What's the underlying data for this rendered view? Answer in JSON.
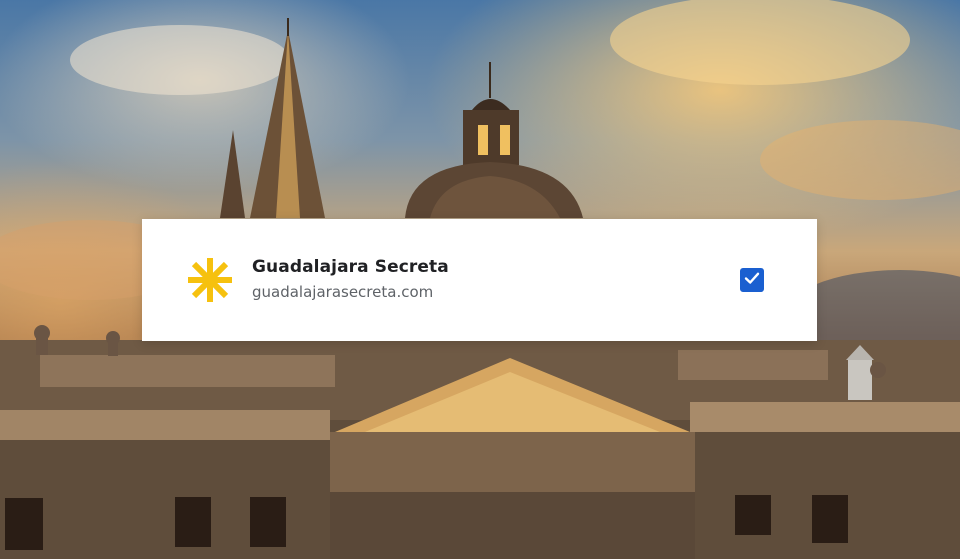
{
  "background": {
    "description_icon": "cathedral-photo"
  },
  "site_card": {
    "logo_icon": "asterisk-logo-icon",
    "logo_color": "#F6C10E",
    "name": "Guadalajara Secreta",
    "url": "guadalajarasecreta.com",
    "checkbox_checked": true,
    "checkbox_color": "#1A5FD0"
  }
}
